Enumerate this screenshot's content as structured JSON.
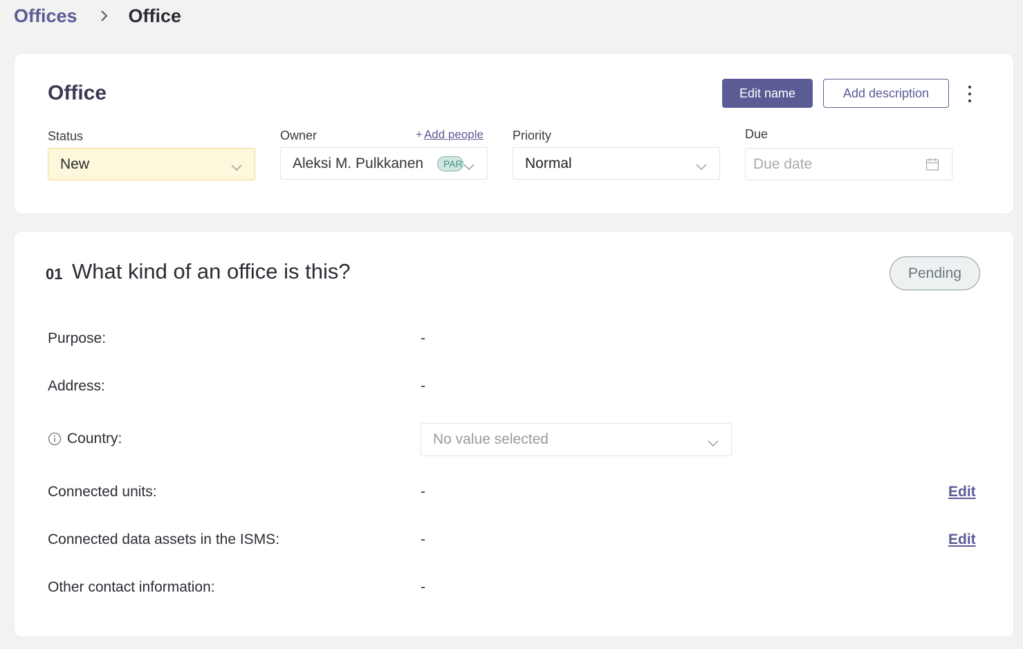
{
  "breadcrumb": {
    "parent": "Offices",
    "current": "Office"
  },
  "header": {
    "title": "Office",
    "edit_name_label": "Edit name",
    "add_description_label": "Add description"
  },
  "fields": {
    "status": {
      "label": "Status",
      "value": "New"
    },
    "owner": {
      "label": "Owner",
      "value": "Aleksi M. Pulkkanen",
      "badge": "PAR",
      "add_people": "Add people"
    },
    "priority": {
      "label": "Priority",
      "value": "Normal"
    },
    "due": {
      "label": "Due",
      "placeholder": "Due date"
    }
  },
  "question": {
    "number": "01",
    "title": "What kind of an office is this?",
    "status": "Pending",
    "rows": [
      {
        "label": "Purpose:",
        "value": "-"
      },
      {
        "label": "Address:",
        "value": "-"
      },
      {
        "label": "Country:",
        "placeholder": "No value selected"
      },
      {
        "label": "Connected units:",
        "value": "-",
        "action": "Edit"
      },
      {
        "label": "Connected data assets in the ISMS:",
        "value": "-",
        "action": "Edit"
      },
      {
        "label": "Other contact information:",
        "value": "-"
      }
    ]
  },
  "colors": {
    "accent": "#5b5b96",
    "status_bg": "#fdf7dc",
    "badge_bg": "#cfe7e2"
  },
  "icons": [
    "chevron-right-icon",
    "chevron-down-icon",
    "calendar-icon",
    "info-icon",
    "kebab-menu-icon"
  ]
}
